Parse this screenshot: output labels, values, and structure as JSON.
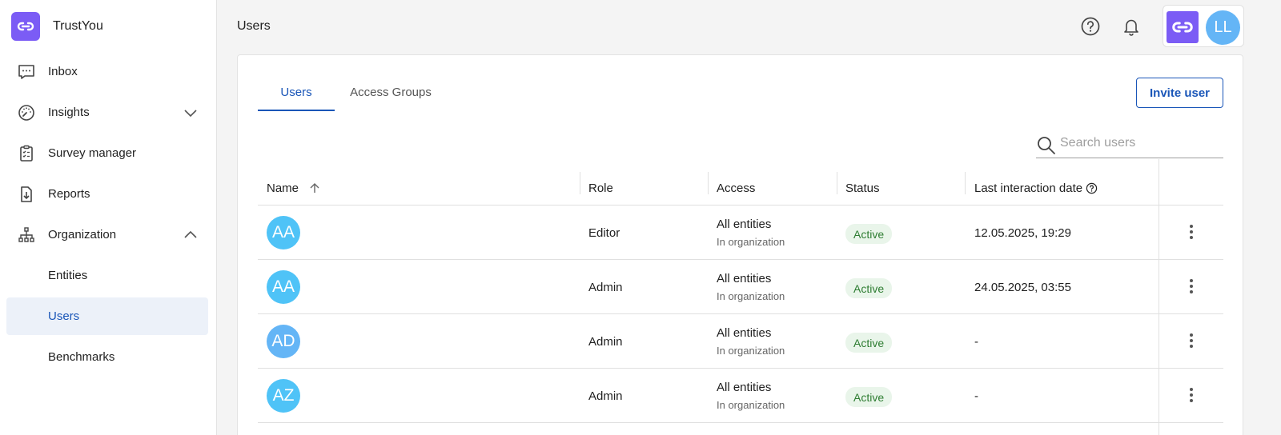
{
  "app": {
    "name": "TrustYou"
  },
  "sidebar": {
    "items": [
      {
        "label": "Inbox"
      },
      {
        "label": "Insights"
      },
      {
        "label": "Survey manager"
      },
      {
        "label": "Reports"
      },
      {
        "label": "Organization"
      },
      {
        "label": "Entities"
      },
      {
        "label": "Users"
      },
      {
        "label": "Benchmarks"
      }
    ]
  },
  "header": {
    "title": "Users",
    "account_initials": "LL"
  },
  "tabs": [
    {
      "label": "Users"
    },
    {
      "label": "Access Groups"
    }
  ],
  "actions": {
    "invite_label": "Invite user"
  },
  "search": {
    "placeholder": "Search users",
    "value": ""
  },
  "table": {
    "columns": [
      "Name",
      "Role",
      "Access",
      "Status",
      "Last interaction date"
    ],
    "rows": [
      {
        "initials": "AA",
        "role": "Editor",
        "access": "All entities",
        "access_sub": "In organization",
        "status": "Active",
        "last": "12.05.2025, 19:29"
      },
      {
        "initials": "AA",
        "role": "Admin",
        "access": "All entities",
        "access_sub": "In organization",
        "status": "Active",
        "last": "24.05.2025, 03:55"
      },
      {
        "initials": "AD",
        "role": "Admin",
        "access": "All entities",
        "access_sub": "In organization",
        "status": "Active",
        "last": "-"
      },
      {
        "initials": "AZ",
        "role": "Admin",
        "access": "All entities",
        "access_sub": "In organization",
        "status": "Active",
        "last": "-"
      }
    ]
  },
  "colors": {
    "brand": "#7b5cf5",
    "accent": "#1a56b8",
    "active_bg": "#e9f5ea",
    "active_text": "#2e7d32",
    "avatar_light": "#4fc3f7",
    "avatar_mid": "#64b5f6"
  },
  "icons": {
    "brand": "link-icon",
    "inbox": "chat-bubble-icon",
    "insights": "gauge-icon",
    "survey": "clipboard-icon",
    "reports": "file-download-icon",
    "organization": "org-tree-icon",
    "help": "help-circle-icon",
    "notifications": "bell-icon",
    "search": "search-icon",
    "sort": "arrow-up-icon",
    "more": "more-vertical-icon"
  }
}
